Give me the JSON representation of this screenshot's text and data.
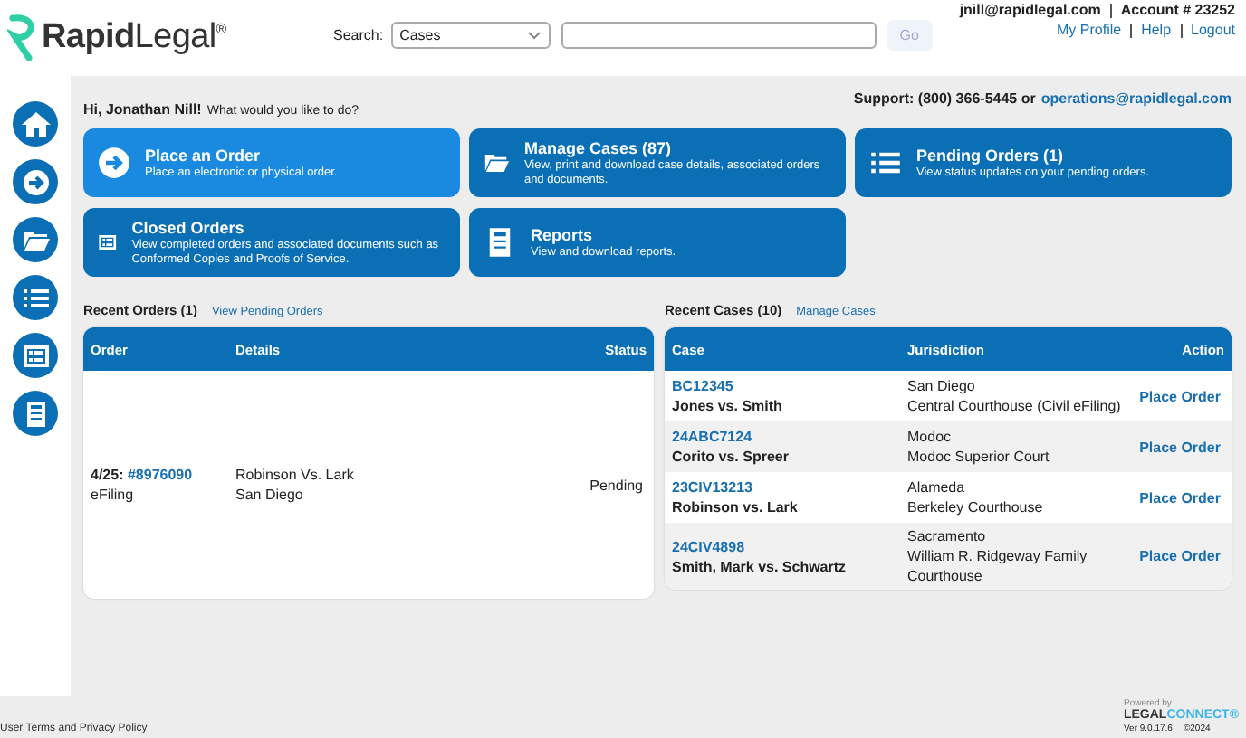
{
  "header": {
    "logo": "**Rapid**Legal$^{®}$",
    "search_label": "Search:",
    "search_scope": "Cases",
    "go_button": "Go",
    "account_email": "jnill@rapidlegal.com",
    "account_number": "Account # 23252",
    "links": [
      "My Profile",
      "Help",
      "Logout"
    ]
  },
  "greeting": {
    "name": "Hi, Jonathan Nill!",
    "prompt": "What would you like to do?"
  },
  "support": {
    "label": "Support: (800) 366-5445 or",
    "email": "operations@rapidlegal.com"
  },
  "tiles": [
    {
      "title": "Place an Order",
      "description": "Place an electronic or physical order.",
      "selected": true
    },
    {
      "title": "Manage Cases (87)",
      "description": "View, print and download case details, associated orders and documents.",
      "selected": false
    },
    {
      "title": "Pending Orders (1)",
      "description": "View status updates on your pending orders.",
      "selected": false
    },
    {
      "title": "Closed Orders",
      "description": "View completed orders and associated documents such as Conformed Copies and Proofs of Service.",
      "selected": false
    },
    {
      "title": "Reports",
      "description": "View and download reports.",
      "selected": false
    }
  ],
  "recent_orders": {
    "title": "Recent Orders (1)",
    "link": "View Pending Orders",
    "columns": [
      "Order",
      "Details",
      "Status"
    ],
    "rows": [
      {
        "date": "4/25:",
        "number": "#8976090",
        "type": "eFiling",
        "case": "Robinson Vs. Lark",
        "location": "San Diego",
        "status": "Pending"
      }
    ]
  },
  "recent_cases": {
    "title": "Recent Cases (10)",
    "link": "Manage Cases",
    "columns": [
      "Case",
      "Jurisdiction",
      "Action"
    ],
    "rows": [
      {
        "number": "BC12345",
        "name": "Jones vs. Smith",
        "county": "San Diego",
        "court": "Central Courthouse (Civil eFiling)",
        "action": "Place Order"
      },
      {
        "number": "24ABC7124",
        "name": "Corito vs. Spreer",
        "county": "Modoc",
        "court": "Modoc Superior Court",
        "action": "Place Order"
      },
      {
        "number": "23CIV13213",
        "name": "Robinson vs. Lark",
        "county": "Alameda",
        "court": "Berkeley Courthouse",
        "action": "Place Order"
      },
      {
        "number": "24CIV4898",
        "name": "Smith, Mark vs. Schwartz",
        "county": "Sacramento",
        "court": "William R. Ridgeway Family Courthouse",
        "action": "Place Order"
      }
    ]
  },
  "footer": {
    "policy_link": "User Terms and Privacy Policy",
    "powered_by": "Powered by",
    "brand_dark": "LEGAL",
    "brand_light": "CONNECT®",
    "version": "Ver 9.0.17.6",
    "copyright": "©2024"
  }
}
